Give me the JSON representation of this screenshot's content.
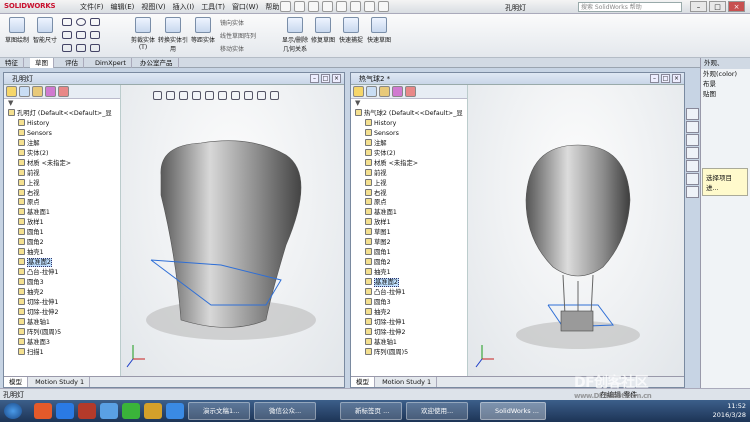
{
  "app": {
    "logo": "SOLIDWORKS",
    "doc_title": "孔明灯",
    "search_placeholder": "搜索 SolidWorks 帮助"
  },
  "menu": [
    "文件(F)",
    "编辑(E)",
    "视图(V)",
    "插入(I)",
    "工具(T)",
    "窗口(W)",
    "帮助(H)"
  ],
  "ribbon": {
    "sketch": "草图绘制",
    "smart_dim": "智能尺寸",
    "trim": "剪裁实体(T)",
    "convert": "转换实体引用",
    "offset": "等距实体",
    "mirror": "镜向实体",
    "linear_pattern": "线性草图阵列",
    "move": "移动实体",
    "show_rel": "显示/删除几何关系",
    "repair": "修复草图",
    "rapid": "快速捕捉",
    "quick": "快速草图"
  },
  "tabs": [
    "特征",
    "草图",
    "评估",
    "DimXpert",
    "办公室产品"
  ],
  "left_pane": {
    "title": "孔明灯",
    "filter": "▼",
    "tree": [
      {
        "label": "孔明灯  (Default<<Default>_显",
        "indent": false
      },
      {
        "label": "History",
        "indent": true
      },
      {
        "label": "Sensors",
        "indent": true
      },
      {
        "label": "注解",
        "indent": true
      },
      {
        "label": "实体(2)",
        "indent": true
      },
      {
        "label": "材质 <未指定>",
        "indent": true
      },
      {
        "label": "前视",
        "indent": true
      },
      {
        "label": "上视",
        "indent": true
      },
      {
        "label": "右视",
        "indent": true
      },
      {
        "label": "原点",
        "indent": true
      },
      {
        "label": "基准面1",
        "indent": true
      },
      {
        "label": "放样1",
        "indent": true
      },
      {
        "label": "圆角1",
        "indent": true
      },
      {
        "label": "圆角2",
        "indent": true
      },
      {
        "label": "抽壳1",
        "indent": true
      },
      {
        "label": "基准面2",
        "indent": true,
        "selected": true
      },
      {
        "label": "凸台-拉伸1",
        "indent": true
      },
      {
        "label": "圆角3",
        "indent": true
      },
      {
        "label": "抽壳2",
        "indent": true
      },
      {
        "label": "切除-拉伸1",
        "indent": true
      },
      {
        "label": "切除-拉伸2",
        "indent": true
      },
      {
        "label": "基准轴1",
        "indent": true
      },
      {
        "label": "阵列(圆周)5",
        "indent": true
      },
      {
        "label": "基准面3",
        "indent": true
      },
      {
        "label": "扫描1",
        "indent": true
      }
    ],
    "tabs": [
      "模型",
      "Motion Study 1"
    ]
  },
  "right_pane": {
    "title": "热气球2 *",
    "filter": "▼",
    "tree": [
      {
        "label": "热气球2  (Default<<Default>_显",
        "indent": false
      },
      {
        "label": "History",
        "indent": true
      },
      {
        "label": "Sensors",
        "indent": true
      },
      {
        "label": "注解",
        "indent": true
      },
      {
        "label": "实体(2)",
        "indent": true
      },
      {
        "label": "材质 <未指定>",
        "indent": true
      },
      {
        "label": "前视",
        "indent": true
      },
      {
        "label": "上视",
        "indent": true
      },
      {
        "label": "右视",
        "indent": true
      },
      {
        "label": "原点",
        "indent": true
      },
      {
        "label": "基准面1",
        "indent": true
      },
      {
        "label": "放样1",
        "indent": true
      },
      {
        "label": "草图1",
        "indent": true
      },
      {
        "label": "草图2",
        "indent": true
      },
      {
        "label": "圆角1",
        "indent": true
      },
      {
        "label": "圆角2",
        "indent": true
      },
      {
        "label": "抽壳1",
        "indent": true
      },
      {
        "label": "基准面2",
        "indent": true,
        "selected": true
      },
      {
        "label": "凸台-拉伸1",
        "indent": true
      },
      {
        "label": "圆角3",
        "indent": true
      },
      {
        "label": "抽壳2",
        "indent": true
      },
      {
        "label": "切除-拉伸1",
        "indent": true
      },
      {
        "label": "切除-拉伸2",
        "indent": true
      },
      {
        "label": "基准轴1",
        "indent": true
      },
      {
        "label": "阵列(圆周)5",
        "indent": true
      }
    ],
    "tabs": [
      "模型",
      "Motion Study 1"
    ]
  },
  "task_pane": {
    "title": "外观、",
    "items": [
      "外观(color)",
      "布景",
      "贴图"
    ],
    "tooltip": "选择项目进..."
  },
  "status_bar": {
    "left": "孔明灯",
    "right": "在编辑 零件"
  },
  "taskbar": {
    "buttons": [
      "演示文稿1...",
      "微信公众...",
      "新标签页 ...",
      "欢迎使用...",
      "SolidWorks ..."
    ],
    "time": "11:52",
    "date": "2016/3/28"
  },
  "watermark": {
    "main": "DF创客社区",
    "sub": "www.DFRobot.com.cn"
  }
}
